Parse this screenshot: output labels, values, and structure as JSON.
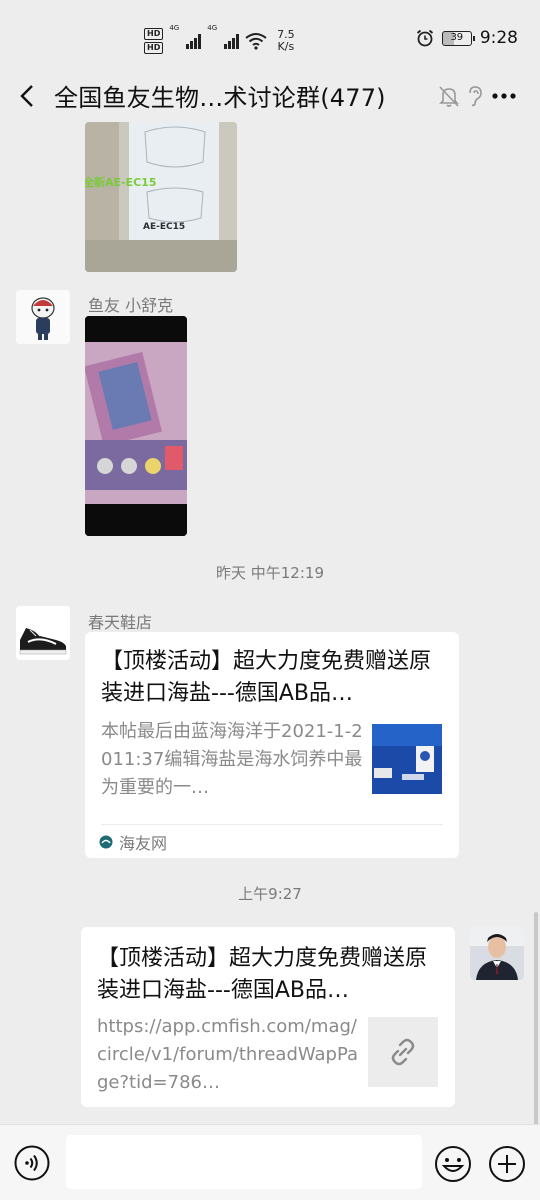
{
  "status_bar": {
    "hd_labels": [
      "HD",
      "HD"
    ],
    "signal_labels": [
      "4G",
      "4G"
    ],
    "net_speed_value": "7.5",
    "net_speed_unit": "K/s",
    "battery": "39",
    "time": "9:28"
  },
  "header": {
    "title": "全国鱼友生物…术讨论群(477)",
    "icons": [
      "back-icon",
      "mute-icon",
      "ear-icon",
      "more-icon"
    ]
  },
  "messages": {
    "image1": {
      "caption_text": "全新AE-EC15",
      "model_label": "AE-EC15"
    },
    "msg2": {
      "sender": "鱼友 小舒克"
    },
    "time1": "昨天 中午12:19",
    "msg3": {
      "sender": "春天鞋店",
      "title": "【顶楼活动】超大力度免费赠送原装进口海盐---德国AB品…",
      "desc": "本帖最后由蓝海海洋于2021-1-2011:37编辑海盐是海水饲养中最为重要的一…",
      "source": "海友网"
    },
    "time2": "上午9:27",
    "msg4": {
      "title": "【顶楼活动】超大力度免费赠送原装进口海盐---德国AB品…",
      "desc": "https://app.cmfish.com/mag/circle/v1/forum/threadWapPage?tid=786…"
    }
  },
  "input_bar": {
    "placeholder": "",
    "icons": [
      "voice-icon",
      "emoji-icon",
      "plus-icon"
    ]
  },
  "colors": {
    "background": "#ededed",
    "card": "#ffffff",
    "secondary_text": "#7a7a7a",
    "source_icon": "#1f6b73"
  }
}
